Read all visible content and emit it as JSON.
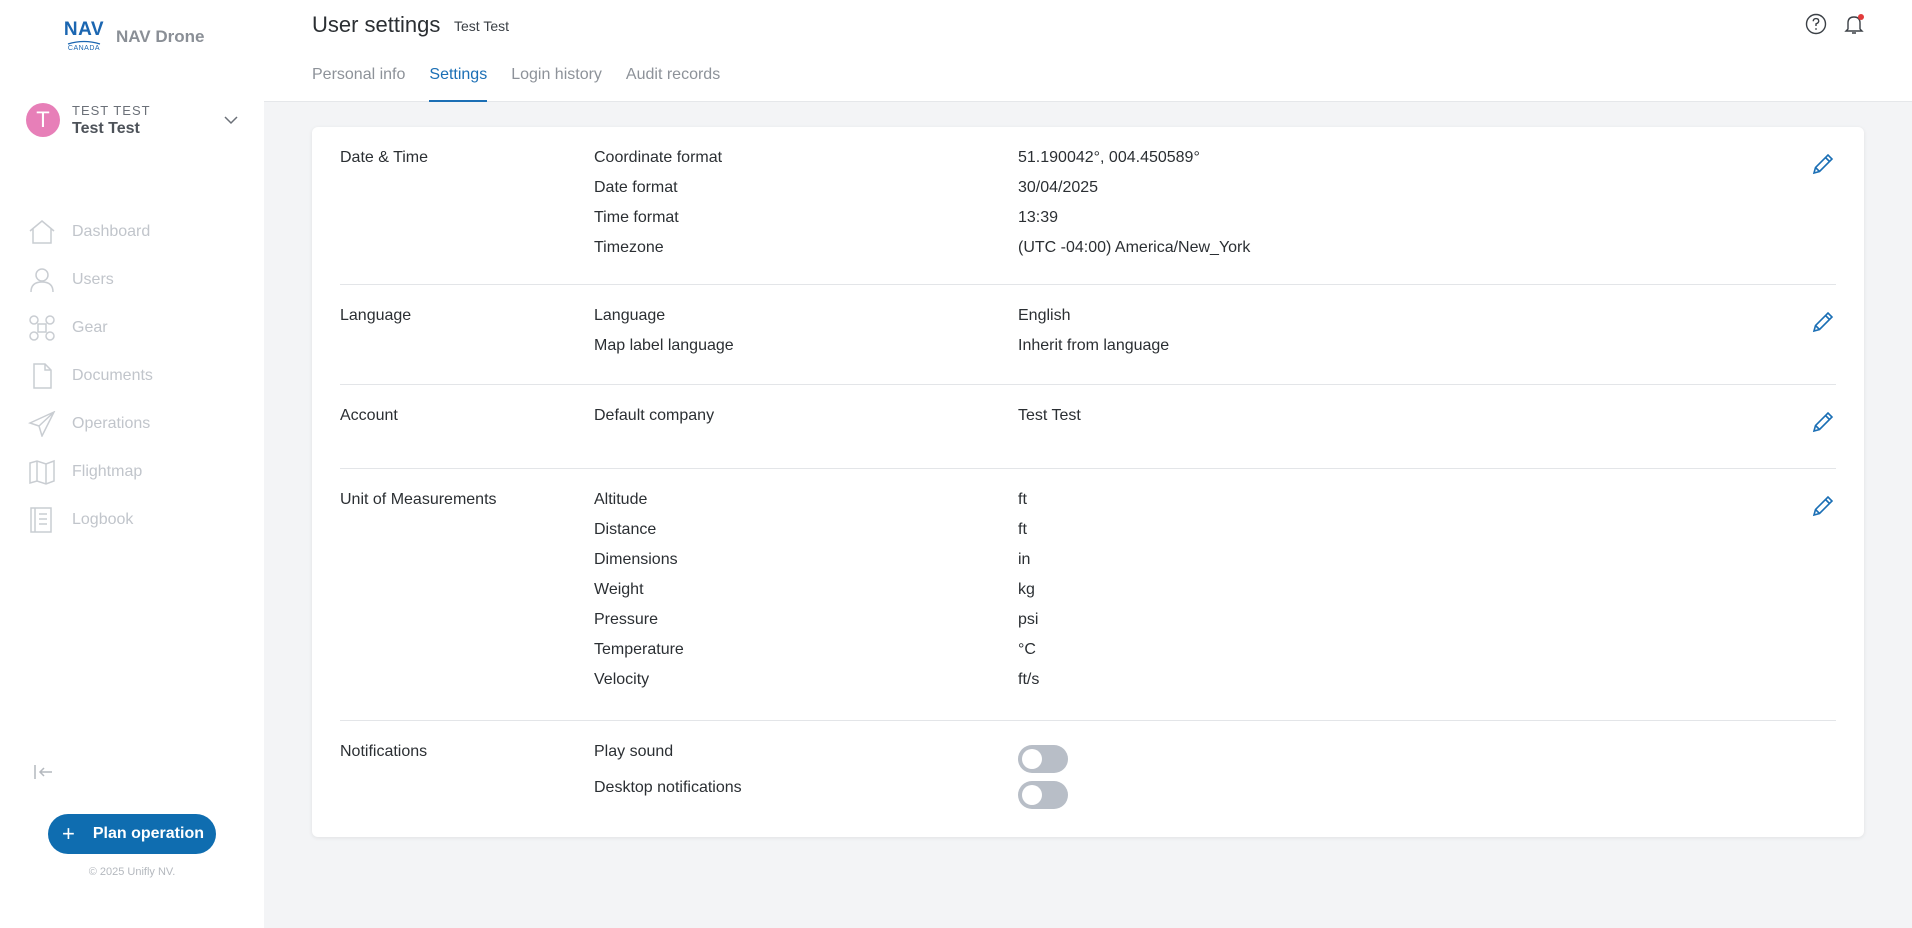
{
  "brand": {
    "logo_top": "NAV",
    "logo_bottom": "CANADA",
    "name": "NAV Drone"
  },
  "user": {
    "initial": "T",
    "upper": "TEST TEST",
    "name": "Test Test"
  },
  "nav": [
    {
      "label": "Dashboard",
      "icon": "home-icon"
    },
    {
      "label": "Users",
      "icon": "user-icon"
    },
    {
      "label": "Gear",
      "icon": "drone-icon"
    },
    {
      "label": "Documents",
      "icon": "document-icon"
    },
    {
      "label": "Operations",
      "icon": "paper-plane-icon"
    },
    {
      "label": "Flightmap",
      "icon": "map-icon"
    },
    {
      "label": "Logbook",
      "icon": "logbook-icon"
    }
  ],
  "plan_button": "Plan operation",
  "copyright": "© 2025 Unifly NV.",
  "header": {
    "title": "User settings",
    "subtitle": "Test Test",
    "tabs": [
      "Personal info",
      "Settings",
      "Login history",
      "Audit records"
    ],
    "active_tab": "Settings"
  },
  "sections": {
    "datetime": {
      "title": "Date & Time",
      "rows": [
        {
          "k": "Coordinate format",
          "v": "51.190042°, 004.450589°"
        },
        {
          "k": "Date format",
          "v": "30/04/2025"
        },
        {
          "k": "Time format",
          "v": "13:39"
        },
        {
          "k": "Timezone",
          "v": "(UTC -04:00) America/New_York"
        }
      ]
    },
    "language": {
      "title": "Language",
      "rows": [
        {
          "k": "Language",
          "v": "English"
        },
        {
          "k": "Map label language",
          "v": "Inherit from language"
        }
      ]
    },
    "account": {
      "title": "Account",
      "rows": [
        {
          "k": "Default company",
          "v": "Test Test"
        }
      ]
    },
    "units": {
      "title": "Unit of Measurements",
      "rows": [
        {
          "k": "Altitude",
          "v": "ft"
        },
        {
          "k": "Distance",
          "v": "ft"
        },
        {
          "k": "Dimensions",
          "v": "in"
        },
        {
          "k": "Weight",
          "v": "kg"
        },
        {
          "k": "Pressure",
          "v": "psi"
        },
        {
          "k": "Temperature",
          "v": "°C"
        },
        {
          "k": "Velocity",
          "v": "ft/s"
        }
      ]
    },
    "notifications": {
      "title": "Notifications",
      "rows": [
        {
          "k": "Play sound",
          "enabled": false
        },
        {
          "k": "Desktop notifications",
          "enabled": false
        }
      ]
    }
  },
  "colors": {
    "accent": "#1b6fb5",
    "avatar": "#e77fb8",
    "button": "#0f6db0"
  }
}
